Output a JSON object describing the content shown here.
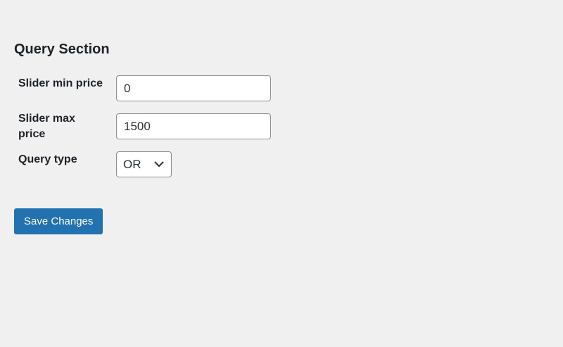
{
  "section": {
    "title": "Query Section"
  },
  "fields": {
    "min_price": {
      "label": "Slider min price",
      "value": "0"
    },
    "max_price": {
      "label": "Slider max price",
      "value": "1500"
    },
    "query_type": {
      "label": "Query type",
      "selected": "OR",
      "icon": "chevron-down-icon"
    }
  },
  "actions": {
    "save_label": "Save Changes"
  },
  "colors": {
    "background": "#f0f0f1",
    "primary": "#2271b1",
    "border": "#8c8f94",
    "text": "#1d2327"
  }
}
